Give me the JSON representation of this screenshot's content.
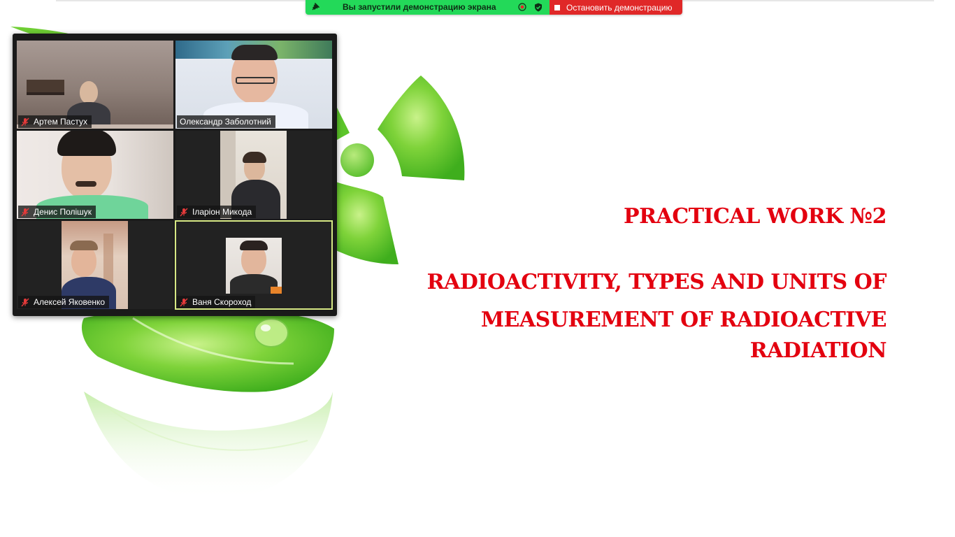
{
  "share_bar": {
    "status_text": "Вы запустили демонстрацию экрана",
    "stop_label": "Остановить демонстрацию",
    "status_color": "#23d959",
    "stop_color": "#e02828"
  },
  "slide": {
    "title": "PRACTICAL WORK №2",
    "subtitle_lines": [
      "RADIOACTIVITY, TYPES AND UNITS OF",
      "MEASUREMENT OF RADIOACTIVE",
      "RADIATION"
    ],
    "text_color": "#e3000f"
  },
  "gallery": {
    "participants": [
      {
        "name": "Артем Пастух",
        "muted": true
      },
      {
        "name": "Олександр Заболотний",
        "muted": false
      },
      {
        "name": "Денис Полішук",
        "muted": true
      },
      {
        "name": "Іларіон Микода",
        "muted": true
      },
      {
        "name": "Алексей Яковенко",
        "muted": true
      },
      {
        "name": "Ваня Скороход",
        "muted": true,
        "active_speaker": true
      }
    ]
  }
}
